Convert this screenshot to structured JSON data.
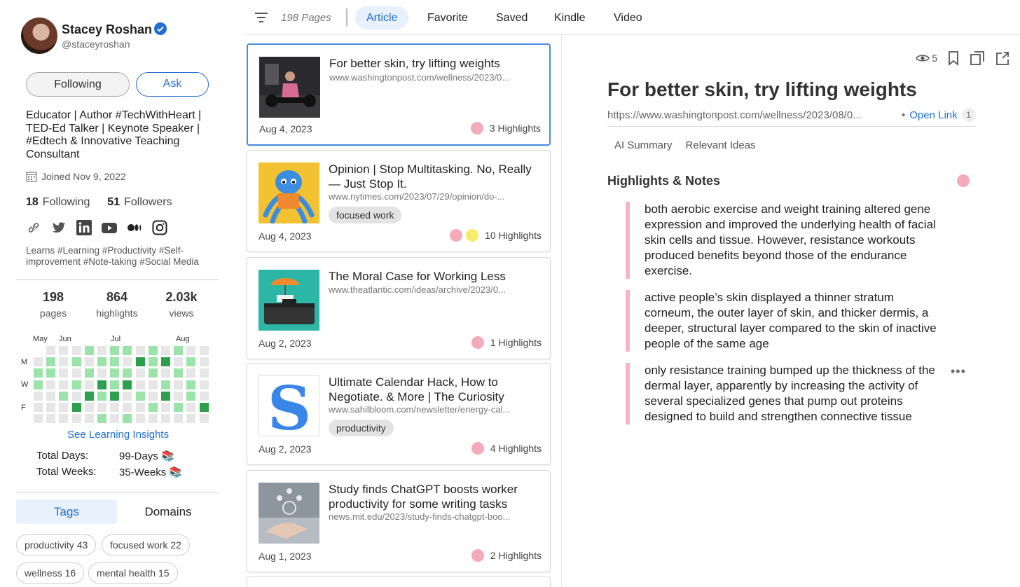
{
  "profile": {
    "name": "Stacey Roshan",
    "handle": "@staceyroshan",
    "following_label": "Following",
    "ask_label": "Ask",
    "bio": "Educator | Author #TechWithHeart | TED-Ed Talker | Keynote Speaker | #Edtech & Innovative Teaching Consultant",
    "joined": "Joined Nov 9, 2022",
    "following_count": "18",
    "following_text": "Following",
    "followers_count": "51",
    "followers_text": "Followers",
    "interests": "Learns #Learning #Productivity #Self-improvement #Note-taking #Social Media",
    "stats": [
      {
        "value": "198",
        "label": "pages"
      },
      {
        "value": "864",
        "label": "highlights"
      },
      {
        "value": "2.03k",
        "label": "views"
      }
    ],
    "heatmap_months": [
      "May",
      "Jun",
      "Jul",
      "Aug"
    ],
    "heatmap_days": [
      "M",
      "W",
      "F"
    ],
    "insights_link": "See Learning Insights",
    "total_days_label": "Total Days:",
    "total_days_value": "99-Days 📚",
    "total_weeks_label": "Total Weeks:",
    "total_weeks_value": "35-Weeks 📚",
    "tab_tags": "Tags",
    "tab_domains": "Domains",
    "chips": [
      "productivity 43",
      "focused work 22",
      "wellness 16",
      "mental health 15"
    ]
  },
  "topbar": {
    "page_count": "198 Pages",
    "tabs": [
      "Article",
      "Favorite",
      "Saved",
      "Kindle",
      "Video"
    ]
  },
  "cards": [
    {
      "title": "For better skin, try lifting weights",
      "url": "www.washingtonpost.com/wellness/2023/0...",
      "tag": "",
      "date": "Aug 4, 2023",
      "highlights": "3 Highlights"
    },
    {
      "title": "Opinion | Stop Multitasking. No, Really — Just Stop It.",
      "url": "www.nytimes.com/2023/07/29/opinion/do-...",
      "tag": "focused work",
      "date": "Aug 4, 2023",
      "highlights": "10 Highlights"
    },
    {
      "title": "The Moral Case for Working Less",
      "url": "www.theatlantic.com/ideas/archive/2023/0...",
      "tag": "",
      "date": "Aug 2, 2023",
      "highlights": "1 Highlights"
    },
    {
      "title": "Ultimate Calendar Hack, How to Negotiate. & More | The Curiosity",
      "url": "www.sahilbloom.com/newsletter/energy-cal...",
      "tag": "productivity",
      "date": "Aug 2, 2023",
      "highlights": "4 Highlights"
    },
    {
      "title": "Study finds ChatGPT boosts worker productivity for some writing tasks",
      "url": "news.mit.edu/2023/study-finds-chatgpt-boo...",
      "tag": "",
      "date": "Aug 1, 2023",
      "highlights": "2 Highlights"
    }
  ],
  "detail": {
    "views": "5",
    "title": "For better skin, try lifting weights",
    "url": "https://www.washingtonpost.com/wellness/2023/08/0...",
    "bullet": "•",
    "open_link": "Open Link",
    "link_count": "1",
    "tab_ai": "AI Summary",
    "tab_ideas": "Relevant Ideas",
    "section_title": "Highlights & Notes",
    "highlights": [
      "both aerobic exercise and weight training altered gene expression and improved the underlying health of facial skin cells and tissue. However, resistance workouts produced benefits beyond those of the endurance exercise.",
      "active people’s skin displayed a thinner stratum corneum, the outer layer of skin, and thicker dermis, a deeper, structural layer compared to the skin of inactive people of the same age",
      "only resistance training bumped up the thickness of the dermal layer, apparently by increasing the activity of several specialized genes that pump out proteins designed to build and strengthen connective tissue"
    ],
    "more": "•••"
  },
  "colors": {
    "accent": "#1f6fd6",
    "highlight_pink": "#f4aab8",
    "highlight_yellow": "#f7ea6e",
    "heat_light": "#9be3a9",
    "heat_dark": "#2e9f4c"
  }
}
